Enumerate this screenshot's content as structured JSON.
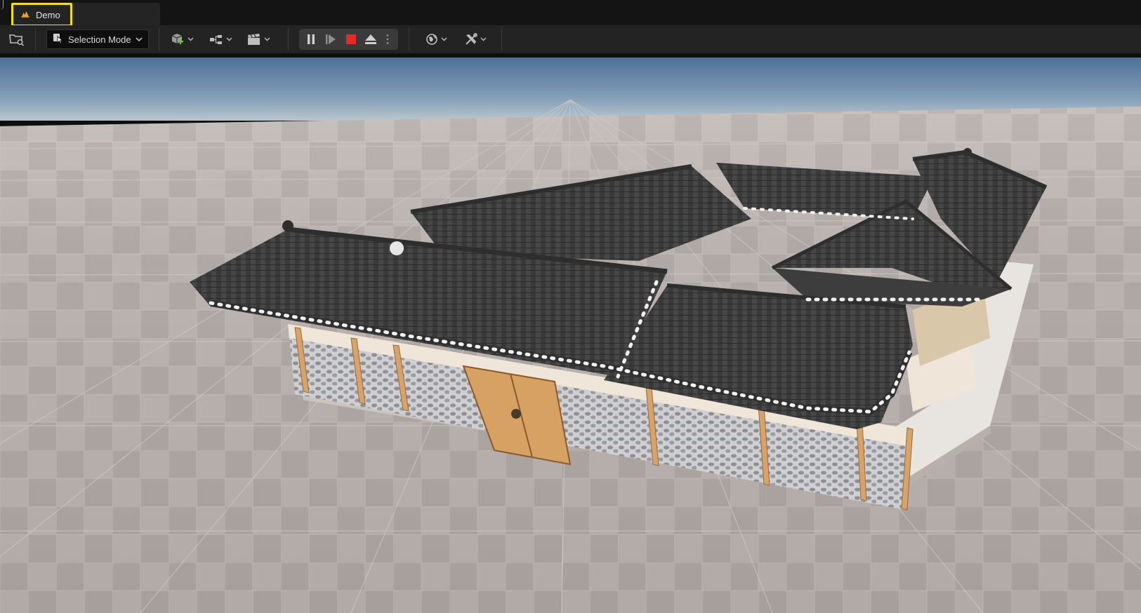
{
  "tabs": [
    {
      "label": "Demo",
      "icon": "unreal-level-icon",
      "highlighted": true
    }
  ],
  "toolbar": {
    "selection_mode_label": "Selection Mode",
    "buttons": [
      "content-browser-icon",
      "selection-mode-dropdown",
      "add-actor-icon",
      "blueprints-icon",
      "cinematics-icon",
      "pause-icon",
      "advance-frame-icon",
      "stop-icon",
      "eject-icon",
      "more-options-icon",
      "world-settings-icon",
      "platforms-icon"
    ]
  },
  "colors": {
    "highlight": "#f2e013",
    "stop": "#e32a2a",
    "add_accent": "#6cc04a"
  }
}
